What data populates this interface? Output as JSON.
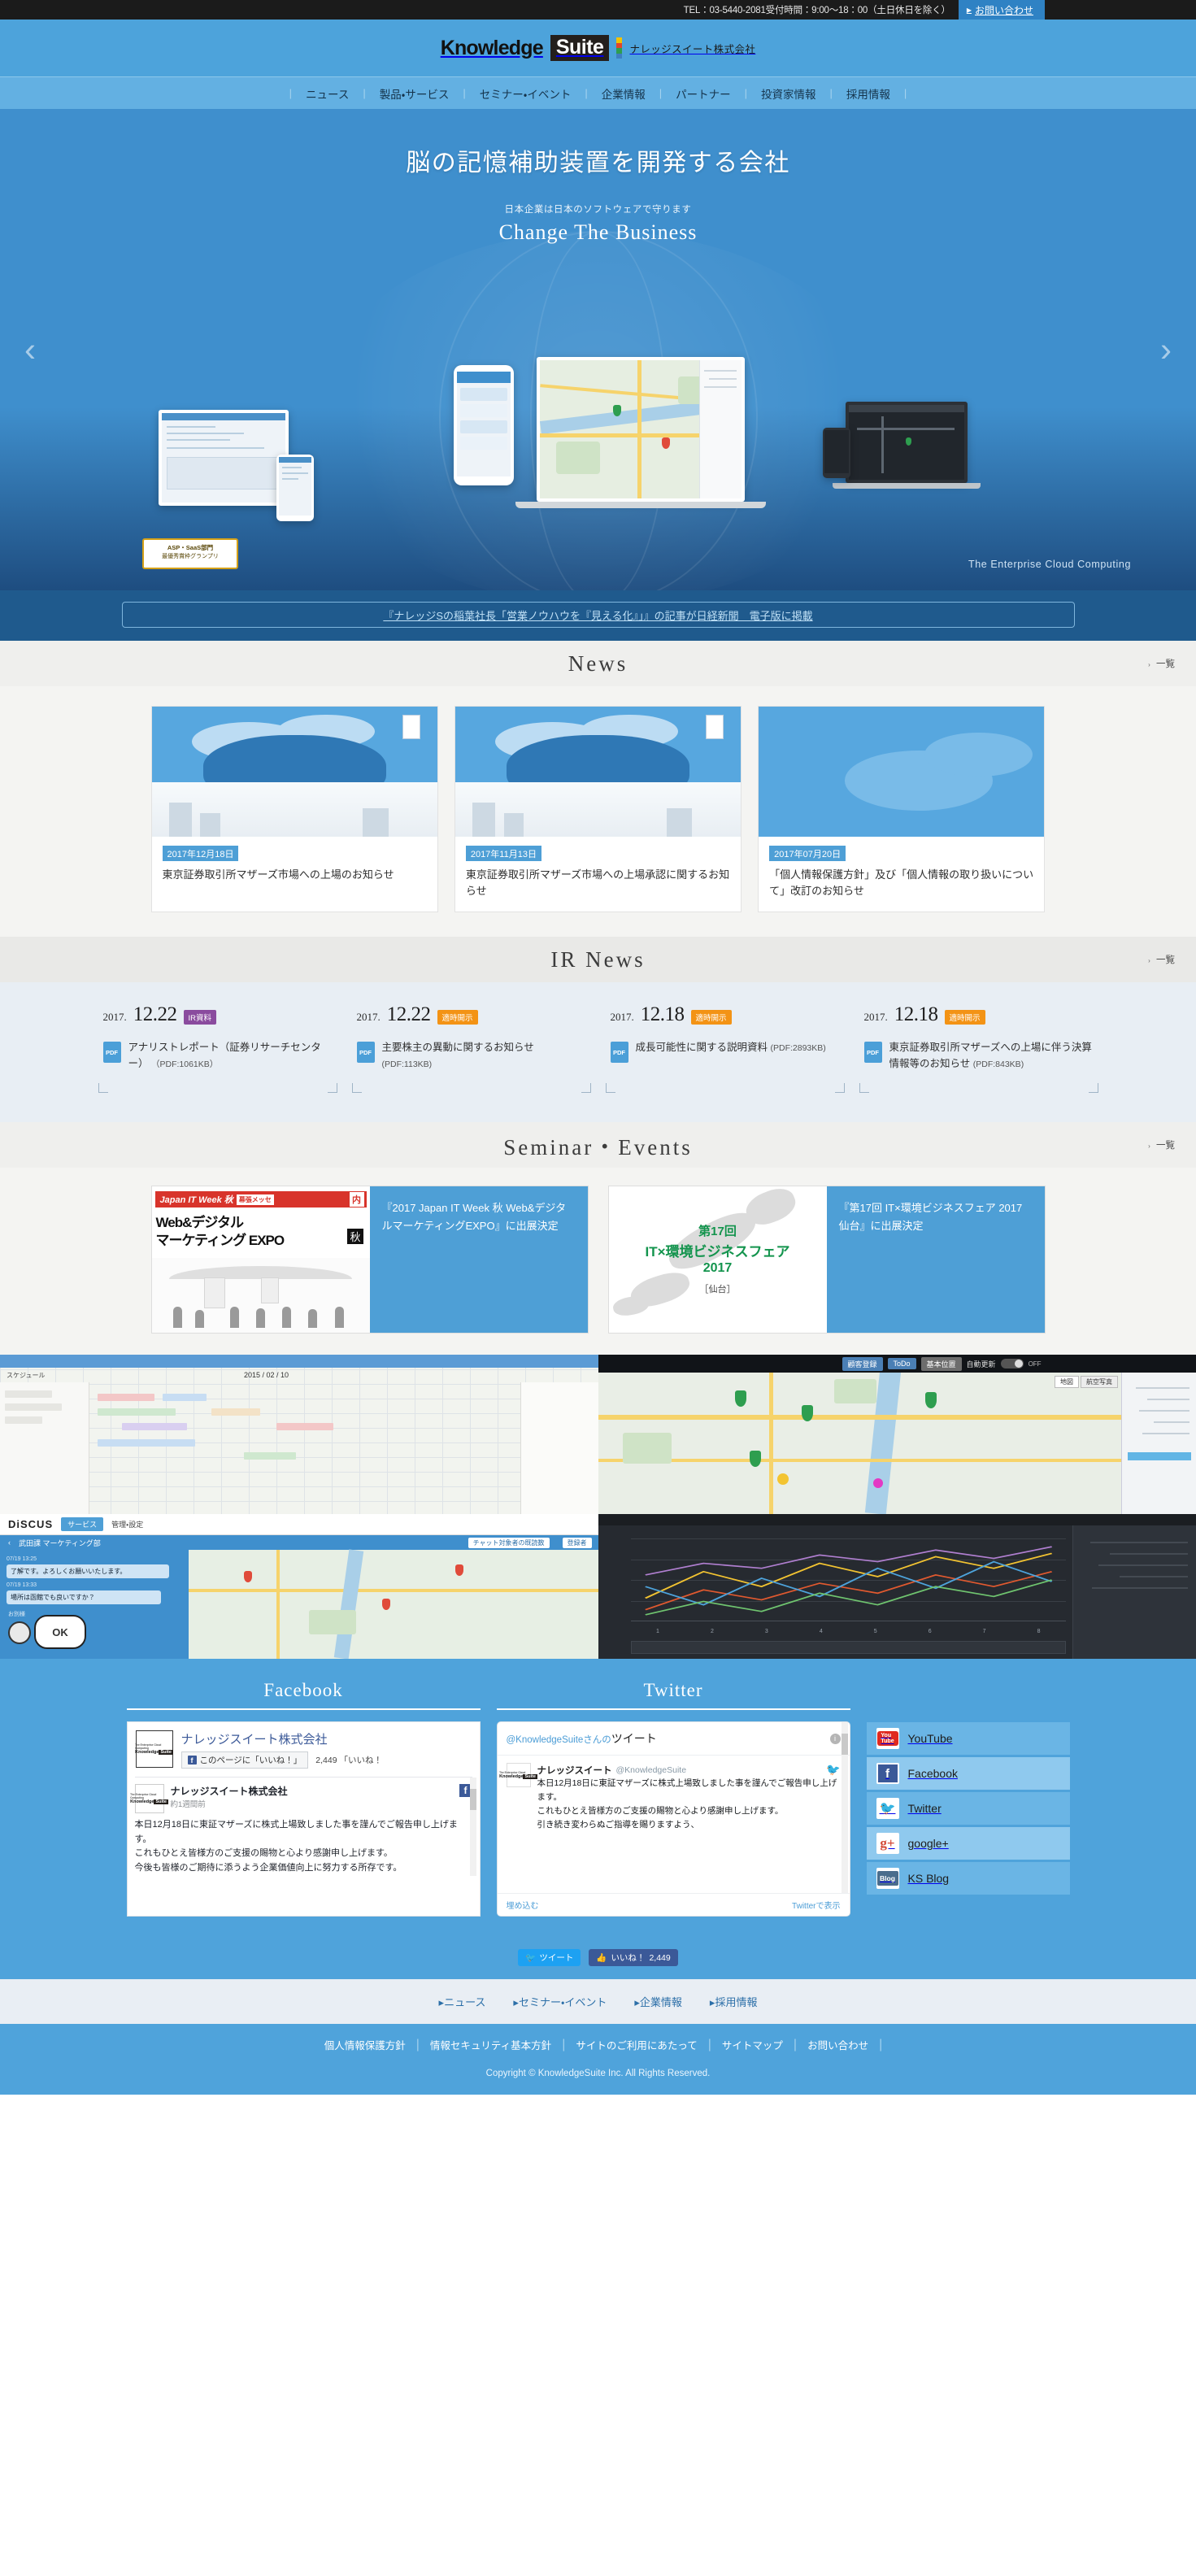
{
  "topbar": {
    "tel": "TEL：03-5440-2081受付時間：9:00～18：00（土日休日を除く）",
    "contact_label": "お問い合わせ",
    "contact_arrow": "▶"
  },
  "header": {
    "logo_knowledge": "Knowledge",
    "logo_suite": "Suite",
    "company": "ナレッジスイート株式会社"
  },
  "gnav": {
    "items": [
      {
        "label": "ニュース"
      },
      {
        "label": "製品・サービス"
      },
      {
        "label": "セミナー・イベント"
      },
      {
        "label": "企業情報"
      },
      {
        "label": "パートナー"
      },
      {
        "label": "投資家情報"
      },
      {
        "label": "採用情報"
      }
    ]
  },
  "hero": {
    "title": "脳の記憶補助装置を開発する会社",
    "subtitle": "日本企業は日本のソフトウェアで守ります",
    "cta": "Change The Business",
    "tagline": "The Enterprise Cloud Computing",
    "award_line1": "ASP・SaaS部門",
    "award_line2": "最優秀賞枠グランプリ",
    "arrow_prev": "‹",
    "arrow_next": "›"
  },
  "ticker": {
    "text": "『ナレッジSの稲葉社長「営業ノウハウを『見える化』」』の記事が日経新聞　電子版に掲載"
  },
  "news": {
    "heading": "News",
    "more_label": "一覧",
    "more_arrow": "›",
    "cards": [
      {
        "date": "2017年12月18日",
        "title": "東京証券取引所マザーズ市場への上場のお知らせ"
      },
      {
        "date": "2017年11月13日",
        "title": "東京証券取引所マザーズ市場への上場承認に関するお知らせ"
      },
      {
        "date": "2017年07月20日",
        "title": "「個人情報保護方針」及び「個人情報の取り扱いについて」改訂のお知らせ"
      }
    ]
  },
  "ir": {
    "heading": "IR News",
    "more_label": "一覧",
    "more_arrow": "›",
    "items": [
      {
        "year": "2017.",
        "date": "12.22",
        "badge": "IR資料",
        "badge_color": "#8a4b9e",
        "doc_icon": "PDF",
        "title": "アナリストレポート（証券リサーチセンター）",
        "filesize": "（PDF:1061KB）"
      },
      {
        "year": "2017.",
        "date": "12.22",
        "badge": "適時開示",
        "badge_color": "#f39315",
        "doc_icon": "PDF",
        "title": "主要株主の異動に関するお知らせ",
        "filesize": "(PDF:113KB)"
      },
      {
        "year": "2017.",
        "date": "12.18",
        "badge": "適時開示",
        "badge_color": "#f39315",
        "doc_icon": "PDF",
        "title": "成長可能性に関する説明資料",
        "filesize": "(PDF:2893KB)"
      },
      {
        "year": "2017.",
        "date": "12.18",
        "badge": "適時開示",
        "badge_color": "#f39315",
        "doc_icon": "PDF",
        "title": "東京証券取引所マザーズへの上場に伴う決算情報等のお知らせ",
        "filesize": "(PDF:843KB)"
      }
    ]
  },
  "seminar": {
    "heading": "Seminar・Events",
    "more_label": "一覧",
    "more_arrow": "›",
    "cards": [
      {
        "poster": {
          "band": "Japan IT Week 秋",
          "band_box": "幕張メッセ",
          "uchi": "内",
          "line1": "Web&デジタル",
          "line2": "マーケティング EXPO",
          "aki": "秋"
        },
        "caption": "『2017 Japan IT Week 秋 Web&デジタルマーケティングEXPO』に出展決定"
      },
      {
        "poster": {
          "line1": "第17回",
          "line2": "IT×環境ビジネスフェア",
          "line3": "2017",
          "line4": "［仙台］"
        },
        "caption": "『第17回 IT×環境ビジネスフェア 2017 仙台』に出展決定"
      }
    ]
  },
  "mosaic": {
    "map_toolbar": {
      "customer": "顧客登録",
      "todo": "ToDo",
      "basic": "基本位置",
      "auto": "自動更新",
      "toggle": "OFF",
      "map_tab": "地図",
      "sat_tab": "航空写真"
    },
    "discus": {
      "logo": "DiSCUS",
      "service": "サービス",
      "admin": "管理・設定",
      "dept": "武田課 マーケティング部",
      "chat_tab": "チャット対象者の既読数",
      "member_tab": "登録者",
      "msg1_time": "07/19 13:25",
      "msg1": "了解です。よろしくお願いいたします。",
      "msg2_time": "07/19 13:33",
      "msg2": "場所は函館でも良いですか？",
      "ok": "OK",
      "sender": "お別様"
    },
    "calendar": {
      "date_label": "2015 / 02 / 10",
      "schedule": "スケジュール"
    }
  },
  "social": {
    "facebook": {
      "heading": "Facebook",
      "page_name": "ナレッジスイート株式会社",
      "like_button": "このページに「いいね！」",
      "like_count": "2,449 「いいね！",
      "post_name": "ナレッジスイート株式会社",
      "post_time": "約1週間前",
      "post_body": "本日12月18日に東証マザーズに株式上場致しました事を謹んでご報告申し上げます。\nこれもひとえ皆様方のご支援の賜物と心より感謝申し上げます。\n今後も皆様のご期待に添うよう企業価値向上に努力する所存です。"
    },
    "twitter": {
      "heading": "Twitter",
      "head_handle": "@KnowledgeSuiteさんの",
      "head_label": "ツイート",
      "tweet_name": "ナレッジスイート",
      "tweet_handle": "@KnowledgeSuite",
      "tweet_body": "本日12月18日に東証マザーズに株式上場致しました事を謹んでご報告申し上げます。\nこれもひとえ皆様方のご支援の賜物と心より感謝申し上げます。\n引き続き変わらぬご指導を賜りますよう、",
      "footer_left": "埋め込む",
      "footer_right": "Twitterで表示"
    },
    "sns_buttons": [
      {
        "label": "YouTube",
        "icon": "youtube-icon"
      },
      {
        "label": "Facebook",
        "icon": "facebook-icon"
      },
      {
        "label": "Twitter",
        "icon": "twitter-icon"
      },
      {
        "label": "google+",
        "icon": "googleplus-icon"
      },
      {
        "label": "KS Blog",
        "icon": "blog-icon"
      }
    ]
  },
  "share": {
    "tweet_label": "ツイート",
    "like_label": "いいね！",
    "like_count": "2,449"
  },
  "footer": {
    "nav": [
      {
        "label": "ニュース"
      },
      {
        "label": "セミナー・イベント"
      },
      {
        "label": "企業情報"
      },
      {
        "label": "採用情報"
      }
    ],
    "links": [
      {
        "label": "個人情報保護方針"
      },
      {
        "label": "情報セキュリティ基本方針"
      },
      {
        "label": "サイトのご利用にあたって"
      },
      {
        "label": "サイトマップ"
      },
      {
        "label": "お問い合わせ"
      }
    ],
    "copyright": "Copyright © KnowledgeSuite Inc. All Rights Reserved."
  },
  "colors": {
    "brand_blue": "#4fa3db",
    "nav_blue": "#63b0e2",
    "dark_bar": "#1b1b1b",
    "badge_orange": "#f39315",
    "badge_purple": "#8a4b9e"
  }
}
